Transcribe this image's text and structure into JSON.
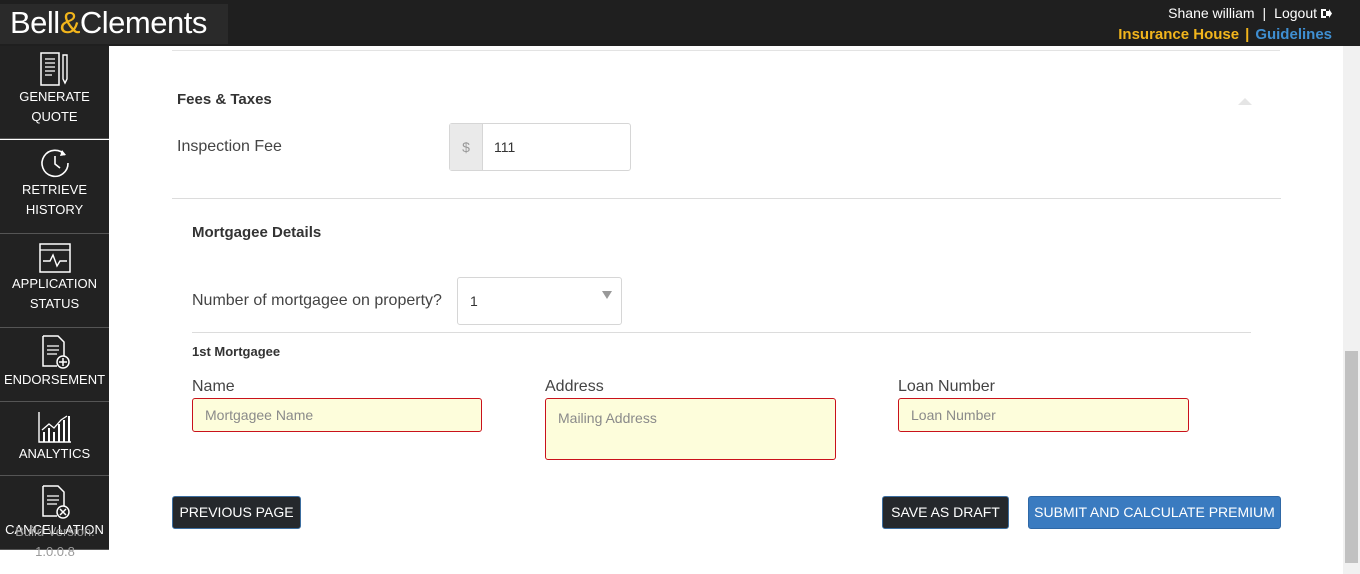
{
  "header": {
    "logo_left": "Bell",
    "logo_amp": "&",
    "logo_right": "Clements",
    "user_name": "Shane william",
    "separator": "|",
    "logout_label": "Logout",
    "insurance_house_link": "Insurance House",
    "guidelines_link": "Guidelines"
  },
  "sidebar": {
    "items": [
      {
        "line1": "GENERATE",
        "line2": "QUOTE",
        "icon": "document-pen-icon"
      },
      {
        "line1": "RETRIEVE",
        "line2": "HISTORY",
        "icon": "clock-history-icon"
      },
      {
        "line1": "APPLICATION",
        "line2": "STATUS",
        "icon": "pulse-window-icon"
      },
      {
        "line1": "ENDORSEMENT",
        "icon": "document-plus-icon"
      },
      {
        "line1": "ANALYTICS",
        "icon": "bar-chart-icon"
      },
      {
        "line1": "CANCELLATION",
        "icon": "document-cancel-icon"
      }
    ],
    "build_label": "Build Version:",
    "build_version": "1.0.0.8"
  },
  "fees": {
    "title": "Fees & Taxes",
    "inspection_fee_label": "Inspection Fee",
    "currency_symbol": "$",
    "inspection_fee_value": "111"
  },
  "mortgagee": {
    "title": "Mortgagee Details",
    "count_label": "Number of mortgagee on property?",
    "count_value": "1",
    "first_title": "1st Mortgagee",
    "name_label": "Name",
    "name_placeholder": "Mortgagee Name",
    "address_label": "Address",
    "address_placeholder": "Mailing Address",
    "loan_label": "Loan Number",
    "loan_placeholder": "Loan Number"
  },
  "actions": {
    "previous": "PREVIOUS PAGE",
    "save_draft": "SAVE AS DRAFT",
    "submit": "SUBMIT AND CALCULATE PREMIUM"
  },
  "colors": {
    "brand_gold": "#f2b51c",
    "link_blue": "#3f8fd2",
    "required_border": "#c9111b",
    "required_fill": "#fdfddb"
  }
}
